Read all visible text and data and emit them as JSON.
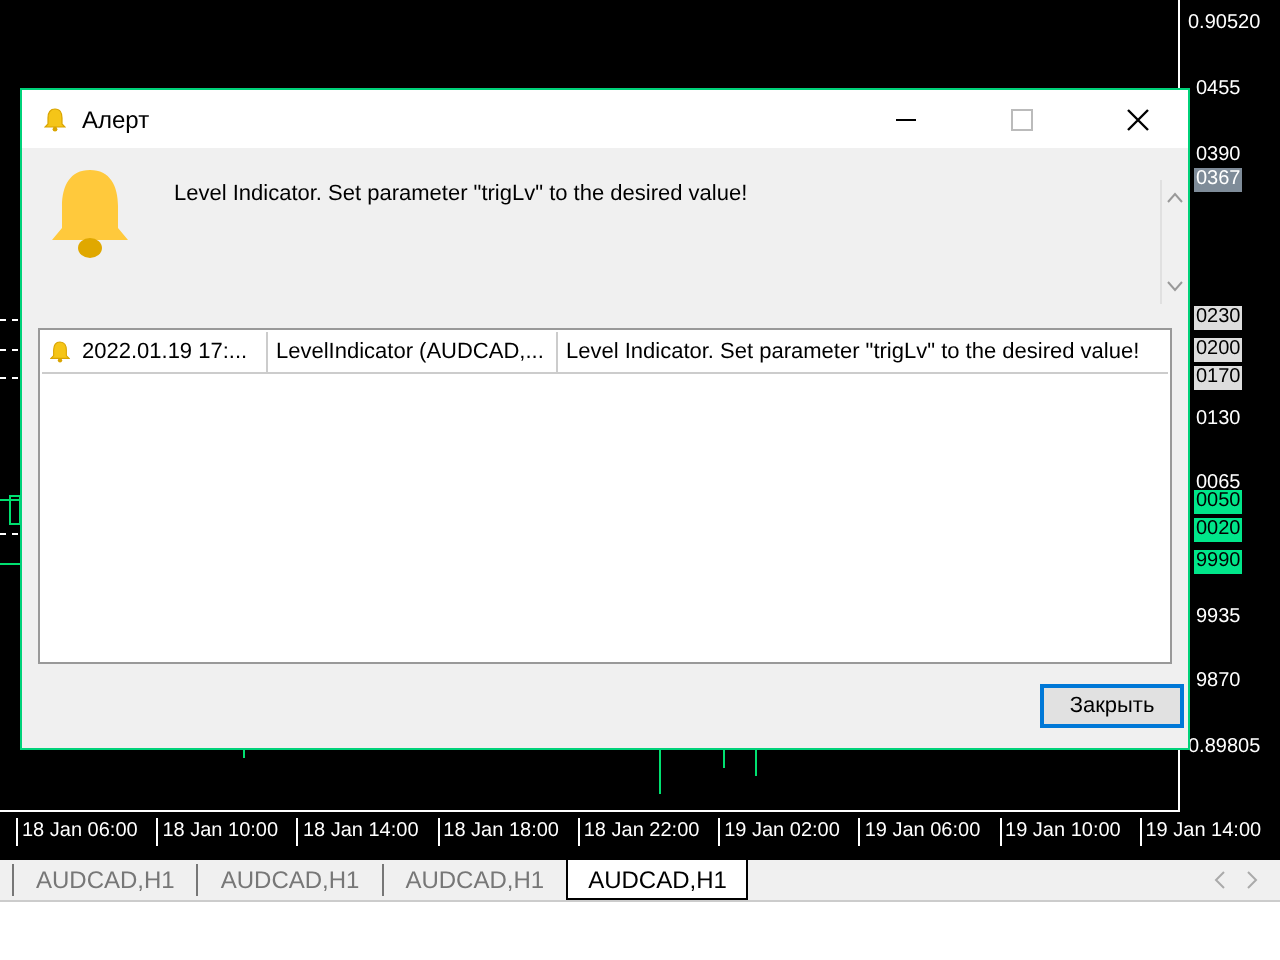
{
  "price_axis": [
    {
      "label": "0.90520",
      "kind": "plain"
    },
    {
      "label": "0455",
      "kind": "plain"
    },
    {
      "label": "0390",
      "kind": "plain"
    },
    {
      "label": "0367",
      "kind": "current"
    },
    {
      "label": "0230",
      "kind": "marker"
    },
    {
      "label": "0200",
      "kind": "marker"
    },
    {
      "label": "0170",
      "kind": "marker"
    },
    {
      "label": "0130",
      "kind": "plain"
    },
    {
      "label": "0065",
      "kind": "plain"
    },
    {
      "label": "0050",
      "kind": "level"
    },
    {
      "label": "0020",
      "kind": "level"
    },
    {
      "label": "9990",
      "kind": "level"
    },
    {
      "label": "9935",
      "kind": "plain"
    },
    {
      "label": "9870",
      "kind": "plain"
    },
    {
      "label": "0.89805",
      "kind": "plain"
    }
  ],
  "time_axis": [
    "18 Jan 06:00",
    "18 Jan 10:00",
    "18 Jan 14:00",
    "18 Jan 18:00",
    "18 Jan 22:00",
    "19 Jan 02:00",
    "19 Jan 06:00",
    "19 Jan 10:00",
    "19 Jan 14:00"
  ],
  "tabs": [
    {
      "label": "AUDCAD,H1",
      "selected": false
    },
    {
      "label": "AUDCAD,H1",
      "selected": false
    },
    {
      "label": "AUDCAD,H1",
      "selected": false
    },
    {
      "label": "AUDCAD,H1",
      "selected": true
    }
  ],
  "dialog": {
    "title": "Алерт",
    "message": "Level Indicator. Set parameter \"trigLv\" to the desired value!",
    "alerts": [
      {
        "time": "2022.01.19 17:...",
        "source": "LevelIndicator (AUDCAD,...",
        "message": "Level Indicator. Set parameter \"trigLv\" to the desired value!"
      }
    ],
    "close_button": "Закрыть"
  }
}
